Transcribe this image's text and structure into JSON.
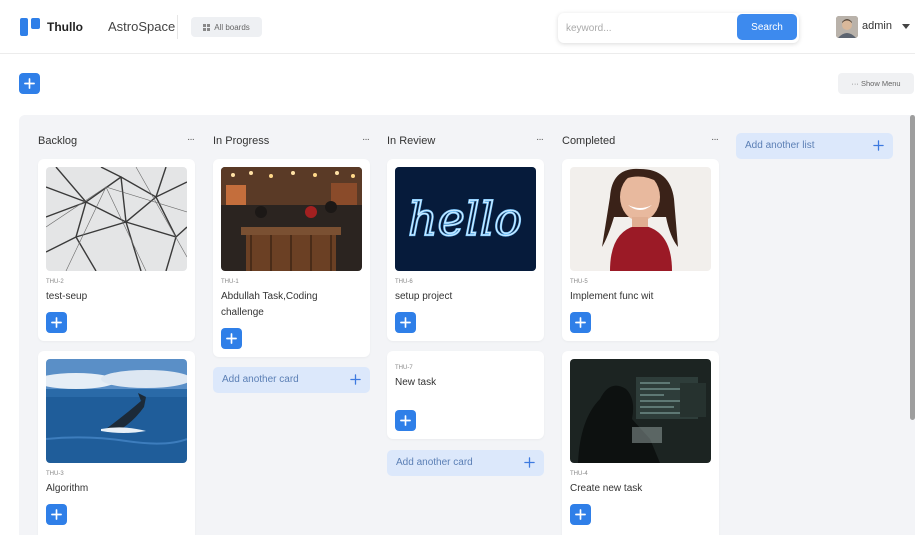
{
  "header": {
    "brand": "Thullo",
    "board_name": "AstroSpace",
    "all_boards_label": "All boards",
    "search_placeholder": "keyword...",
    "search_label": "Search",
    "username": "admin"
  },
  "toolbar": {
    "show_menu_label": "··· Show Menu"
  },
  "lists": [
    {
      "title": "Backlog",
      "menu": "···",
      "cards": [
        {
          "code": "THU-2",
          "title": "test-seup",
          "image": "network-lines"
        },
        {
          "code": "THU-3",
          "title": "Algorithm",
          "image": "whale-ocean"
        }
      ]
    },
    {
      "title": "In Progress",
      "menu": "···",
      "cards": [
        {
          "code": "THU-1",
          "title": "Abdullah Task,Coding challenge",
          "image": "restaurant-night"
        }
      ],
      "add_card_label": "Add another card"
    },
    {
      "title": "In Review",
      "menu": "···",
      "cards": [
        {
          "code": "THU-6",
          "title": "setup project",
          "image": "neon-hello"
        },
        {
          "code": "THU-7",
          "title": "New task",
          "image": ""
        }
      ],
      "add_card_label": "Add another card"
    },
    {
      "title": "Completed",
      "menu": "···",
      "cards": [
        {
          "code": "THU-5",
          "title": "Implement func wit",
          "image": "smiling-woman"
        },
        {
          "code": "THU-4",
          "title": "Create new task",
          "image": "hacker-dark"
        }
      ]
    }
  ],
  "add_list_label": "Add another list",
  "colors": {
    "accent": "#2f7fe8",
    "board_bg": "#f3f4f7",
    "add_card_bg": "#dce8fb"
  }
}
